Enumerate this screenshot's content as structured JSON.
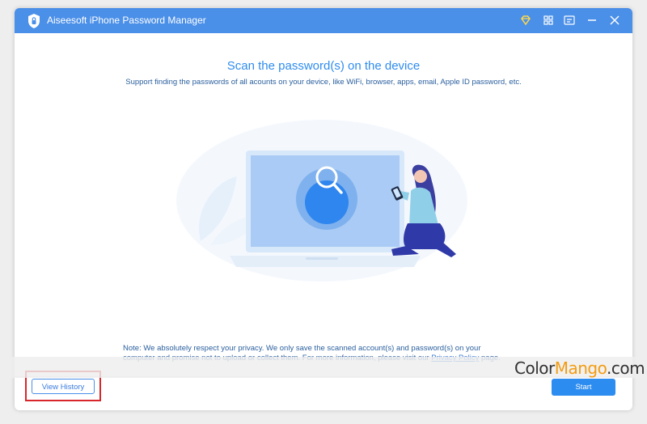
{
  "window": {
    "title": "Aiseesoft iPhone Password Manager",
    "accent_color": "#4a8fe8"
  },
  "titlebar_icons": [
    "diamond-icon",
    "grid-menu-icon",
    "feedback-icon",
    "minimize-icon",
    "close-icon"
  ],
  "main": {
    "heading": "Scan the password(s) on the device",
    "subheading": "Support finding the passwords of all acounts on your device, like  WiFi, browser, apps, email, Apple ID password, etc.",
    "note_prefix": "Note: We absolutely respect your privacy. We only save the scanned account(s) and password(s) on your computer and promise not to upload or collect them. For more information, please visit our ",
    "privacy_link": "Privacy Policy",
    "note_suffix": " page."
  },
  "footer": {
    "view_history_label": "View History",
    "start_label": "Start"
  },
  "watermark": {
    "part1": "Color",
    "part2": "Mango",
    "part3": ".com"
  }
}
